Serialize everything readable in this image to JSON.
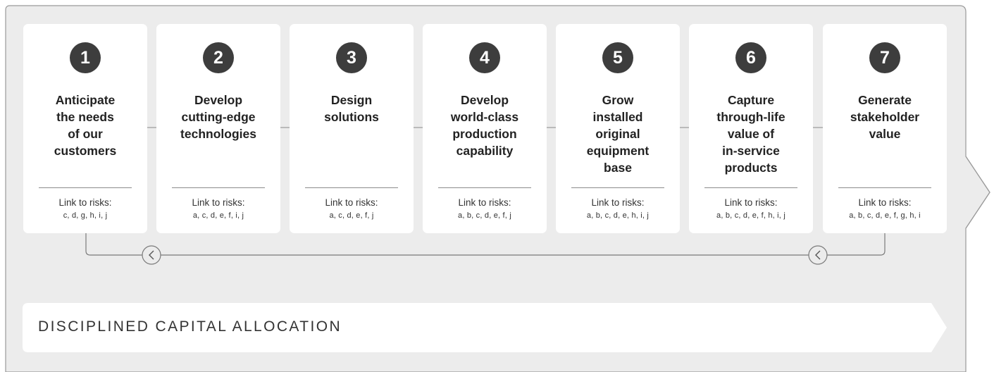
{
  "steps": [
    {
      "number": "1",
      "title_lines": [
        "Anticipate",
        "the needs",
        "of our",
        "customers"
      ],
      "risk_label": "Link to risks:",
      "risks": "c, d, g, h, i, j"
    },
    {
      "number": "2",
      "title_lines": [
        "Develop",
        "cutting-edge",
        "technologies"
      ],
      "risk_label": "Link to risks:",
      "risks": "a, c, d, e, f, i, j"
    },
    {
      "number": "3",
      "title_lines": [
        "Design",
        "solutions"
      ],
      "risk_label": "Link to risks:",
      "risks": "a, c, d, e, f, j"
    },
    {
      "number": "4",
      "title_lines": [
        "Develop",
        "world-class",
        "production",
        "capability"
      ],
      "risk_label": "Link to risks:",
      "risks": "a, b, c, d, e, f, j"
    },
    {
      "number": "5",
      "title_lines": [
        "Grow",
        "installed",
        "original",
        "equipment",
        "base"
      ],
      "risk_label": "Link to risks:",
      "risks": "a, b, c, d, e, h, i, j"
    },
    {
      "number": "6",
      "title_lines": [
        "Capture",
        "through-life",
        "value of",
        "in-service",
        "products"
      ],
      "risk_label": "Link to risks:",
      "risks": "a, b, c, d, e, f, h, i, j"
    },
    {
      "number": "7",
      "title_lines": [
        "Generate",
        "stakeholder",
        "value"
      ],
      "risk_label": "Link to risks:",
      "risks": "a, b, c, d, e, f, g, h, i"
    }
  ],
  "banner": {
    "label": "DISCIPLINED CAPITAL ALLOCATION"
  },
  "colors": {
    "panel_bg": "#ececec",
    "panel_border": "#9a9a9a",
    "card_bg": "#ffffff",
    "badge": "#3d3d3d",
    "connector": "#7a7a7a"
  },
  "icons": [
    "chevron-left-icon",
    "chevron-right-icon"
  ]
}
